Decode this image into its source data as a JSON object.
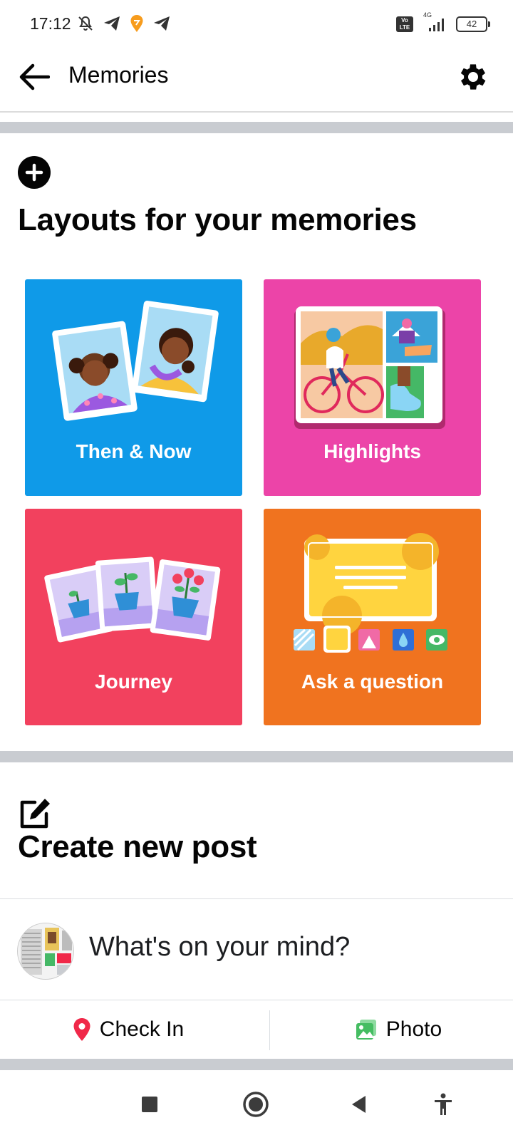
{
  "status_bar": {
    "time": "17:12",
    "network": "4G",
    "battery": "42"
  },
  "app_bar": {
    "title": "Memories"
  },
  "layouts": {
    "title": "Layouts for your memories",
    "tiles": [
      {
        "label": "Then & Now",
        "color": "#0f9ae8"
      },
      {
        "label": "Highlights",
        "color": "#ec44a8"
      },
      {
        "label": "Journey",
        "color": "#f2415e"
      },
      {
        "label": "Ask a question",
        "color": "#f0731f"
      }
    ]
  },
  "create_post": {
    "title": "Create new post",
    "placeholder": "What's on your mind?",
    "check_in_label": "Check In",
    "photo_label": "Photo"
  },
  "colors": {
    "divider": "#c9ccd1",
    "check_in_pin": "#f02849",
    "photo_icon": "#45bd62"
  }
}
